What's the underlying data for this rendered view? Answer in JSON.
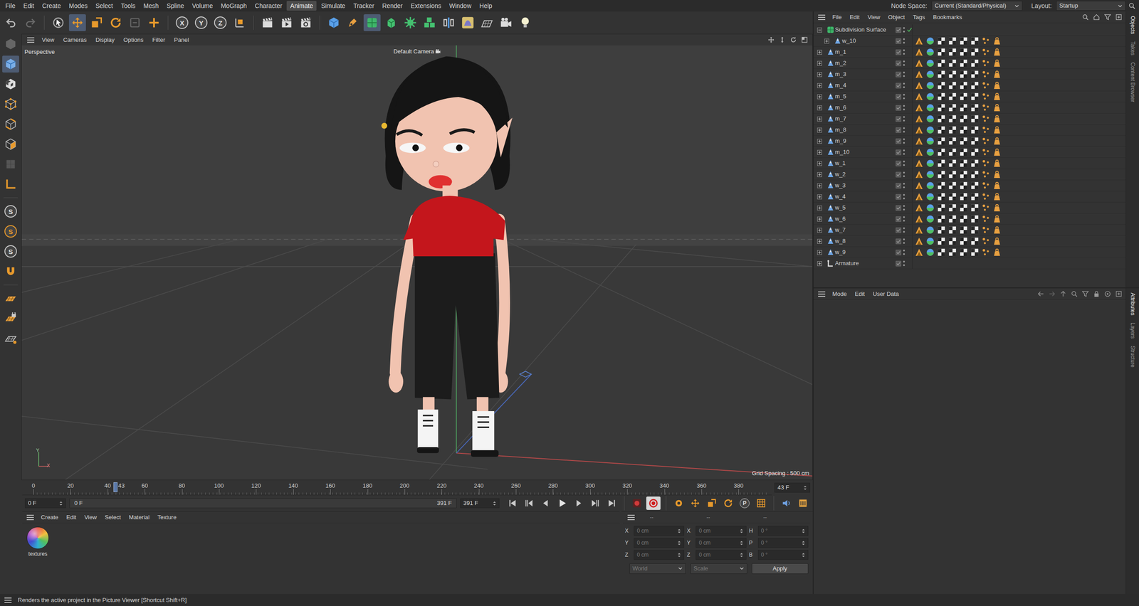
{
  "menubar": {
    "items": [
      {
        "label": "File",
        "selected": false
      },
      {
        "label": "Edit",
        "selected": false
      },
      {
        "label": "Create",
        "selected": false
      },
      {
        "label": "Modes",
        "selected": false
      },
      {
        "label": "Select",
        "selected": false
      },
      {
        "label": "Tools",
        "selected": false
      },
      {
        "label": "Mesh",
        "selected": false
      },
      {
        "label": "Spline",
        "selected": false
      },
      {
        "label": "Volume",
        "selected": false
      },
      {
        "label": "MoGraph",
        "selected": false
      },
      {
        "label": "Character",
        "selected": false
      },
      {
        "label": "Animate",
        "selected": true
      },
      {
        "label": "Simulate",
        "selected": false
      },
      {
        "label": "Tracker",
        "selected": false
      },
      {
        "label": "Render",
        "selected": false
      },
      {
        "label": "Extensions",
        "selected": false
      },
      {
        "label": "Window",
        "selected": false
      },
      {
        "label": "Help",
        "selected": false
      }
    ],
    "node_space": {
      "label": "Node Space:",
      "value": "Current (Standard/Physical)"
    },
    "layout": {
      "label": "Layout:",
      "value": "Startup"
    }
  },
  "toolbar": {
    "tools": [
      {
        "kind": "undo",
        "selected": false
      },
      {
        "kind": "redo",
        "selected": false
      },
      {
        "kind": "separator"
      },
      {
        "kind": "select",
        "selected": false
      },
      {
        "kind": "move",
        "selected": true
      },
      {
        "kind": "scale",
        "selected": false
      },
      {
        "kind": "rotate",
        "selected": false
      },
      {
        "kind": "recent",
        "selected": false
      },
      {
        "kind": "add",
        "selected": false
      },
      {
        "kind": "separator"
      },
      {
        "kind": "axis",
        "label": "X",
        "selected": false
      },
      {
        "kind": "axis",
        "label": "Y",
        "selected": false
      },
      {
        "kind": "axis",
        "label": "Z",
        "selected": false
      },
      {
        "kind": "coord",
        "selected": false
      },
      {
        "kind": "separator"
      },
      {
        "kind": "clapper",
        "selected": false
      },
      {
        "kind": "render",
        "selected": false
      },
      {
        "kind": "rsettings",
        "selected": false
      },
      {
        "kind": "separator"
      },
      {
        "kind": "cube",
        "selected": false
      },
      {
        "kind": "pen",
        "selected": false
      },
      {
        "kind": "subdiv",
        "selected": true
      },
      {
        "kind": "extrude",
        "selected": false
      },
      {
        "kind": "cloner",
        "selected": false
      },
      {
        "kind": "array",
        "selected": false
      },
      {
        "kind": "symmetry",
        "selected": false
      },
      {
        "kind": "deformer",
        "selected": false
      },
      {
        "kind": "floor",
        "selected": false
      },
      {
        "kind": "camera",
        "selected": false
      },
      {
        "kind": "light",
        "selected": false
      }
    ]
  },
  "left_toolbar": {
    "tools": [
      {
        "kind": "model",
        "selected": false
      },
      {
        "kind": "object",
        "selected": true
      },
      {
        "kind": "texture",
        "selected": false
      },
      {
        "kind": "points",
        "selected": false
      },
      {
        "kind": "edges",
        "selected": false
      },
      {
        "kind": "polygons",
        "selected": false
      },
      {
        "kind": "uv",
        "selected": false
      },
      {
        "kind": "axisl",
        "selected": false
      },
      {
        "kind": "separator"
      },
      {
        "kind": "snap",
        "label": "S",
        "selected": false
      },
      {
        "kind": "snap-active",
        "label": "S",
        "selected": false
      },
      {
        "kind": "snap",
        "label": "S",
        "selected": false
      },
      {
        "kind": "magnet",
        "selected": false
      },
      {
        "kind": "separator"
      },
      {
        "kind": "workplane",
        "selected": false
      },
      {
        "kind": "wplock",
        "selected": false
      },
      {
        "kind": "gridsnap",
        "selected": false
      }
    ]
  },
  "viewport": {
    "menu": [
      {
        "label": "View",
        "selected": false
      },
      {
        "label": "Cameras",
        "selected": false
      },
      {
        "label": "Display",
        "selected": false
      },
      {
        "label": "Options",
        "selected": true
      },
      {
        "label": "Filter",
        "selected": false
      },
      {
        "label": "Panel",
        "selected": false
      }
    ],
    "view_name": "Perspective",
    "camera": "Default Camera",
    "grid_spacing": "Grid Spacing : 500 cm",
    "axis": {
      "y": "Y",
      "x": "X"
    }
  },
  "timeline": {
    "ticks": [
      "0",
      "20",
      "40",
      "60",
      "80",
      "100",
      "120",
      "140",
      "160",
      "180",
      "200",
      "220",
      "240",
      "260",
      "280",
      "300",
      "320",
      "340",
      "360",
      "380"
    ],
    "current": "43",
    "level": 0.109,
    "frame": "43 F"
  },
  "transport": {
    "start": "0 F",
    "range_start": "0 F",
    "range_end": "391 F",
    "end": "391 F",
    "controls": [
      {
        "kind": "first",
        "selected": false
      },
      {
        "kind": "prevkey",
        "selected": false
      },
      {
        "kind": "prev",
        "selected": false
      },
      {
        "kind": "play",
        "selected": false
      },
      {
        "kind": "next",
        "selected": false
      },
      {
        "kind": "nextkey",
        "selected": false
      },
      {
        "kind": "last",
        "selected": false
      },
      {
        "kind": "separator"
      },
      {
        "kind": "record",
        "selected": false
      },
      {
        "kind": "autokey",
        "selected": true
      },
      {
        "kind": "separator"
      },
      {
        "kind": "keysel",
        "selected": false
      },
      {
        "kind": "move",
        "selected": false
      },
      {
        "kind": "scale",
        "selected": false
      },
      {
        "kind": "rotate",
        "selected": false
      },
      {
        "kind": "param",
        "label": "P",
        "selected": false
      },
      {
        "kind": "pla",
        "selected": false
      },
      {
        "kind": "separator"
      },
      {
        "kind": "sound",
        "selected": false
      },
      {
        "kind": "tlview",
        "selected": false
      }
    ]
  },
  "materials": {
    "menu": [
      "Create",
      "Edit",
      "View",
      "Select",
      "Material",
      "Texture"
    ],
    "items": [
      {
        "name": "textures",
        "selected": false
      }
    ]
  },
  "coordinates": {
    "headers": [
      "--",
      "--",
      "--"
    ],
    "disabled": true,
    "rows": [
      {
        "pos_label": "X",
        "pos": "0 cm",
        "size_label": "X",
        "size": "0 cm",
        "rot_label": "H",
        "rot": "0 °"
      },
      {
        "pos_label": "Y",
        "pos": "0 cm",
        "size_label": "Y",
        "size": "0 cm",
        "rot_label": "P",
        "rot": "0 °"
      },
      {
        "pos_label": "Z",
        "pos": "0 cm",
        "size_label": "Z",
        "size": "0 cm",
        "rot_label": "B",
        "rot": "0 °"
      }
    ],
    "mode": "World",
    "type": "Scale",
    "apply": "Apply"
  },
  "objects": {
    "menu": [
      {
        "label": "File",
        "selected": false
      },
      {
        "label": "Edit",
        "selected": false
      },
      {
        "label": "View",
        "selected": false
      },
      {
        "label": "Object",
        "selected": false
      },
      {
        "label": "Tags",
        "selected": true
      },
      {
        "label": "Bookmarks",
        "selected": false
      }
    ],
    "items": [
      {
        "name": "Subdivision Surface",
        "kind": "subdivision",
        "child": false,
        "expanded": true,
        "tags": false,
        "checked": true
      },
      {
        "name": "w_10",
        "kind": "mesh",
        "child": true,
        "expanded": false,
        "tags": true,
        "checked": false
      },
      {
        "name": "m_1",
        "kind": "mesh",
        "child": false,
        "expanded": false,
        "tags": true,
        "checked": false
      },
      {
        "name": "m_2",
        "kind": "mesh",
        "child": false,
        "expanded": false,
        "tags": true,
        "checked": false
      },
      {
        "name": "m_3",
        "kind": "mesh",
        "child": false,
        "expanded": false,
        "tags": true,
        "checked": false
      },
      {
        "name": "m_4",
        "kind": "mesh",
        "child": false,
        "expanded": false,
        "tags": true,
        "checked": false
      },
      {
        "name": "m_5",
        "kind": "mesh",
        "child": false,
        "expanded": false,
        "tags": true,
        "checked": false
      },
      {
        "name": "m_6",
        "kind": "mesh",
        "child": false,
        "expanded": false,
        "tags": true,
        "checked": false
      },
      {
        "name": "m_7",
        "kind": "mesh",
        "child": false,
        "expanded": false,
        "tags": true,
        "checked": false
      },
      {
        "name": "m_8",
        "kind": "mesh",
        "child": false,
        "expanded": false,
        "tags": true,
        "checked": false
      },
      {
        "name": "m_9",
        "kind": "mesh",
        "child": false,
        "expanded": false,
        "tags": true,
        "checked": false
      },
      {
        "name": "m_10",
        "kind": "mesh",
        "child": false,
        "expanded": false,
        "tags": true,
        "checked": false
      },
      {
        "name": "w_1",
        "kind": "mesh",
        "child": false,
        "expanded": false,
        "tags": true,
        "checked": false
      },
      {
        "name": "w_2",
        "kind": "mesh",
        "child": false,
        "expanded": false,
        "tags": true,
        "checked": false
      },
      {
        "name": "w_3",
        "kind": "mesh",
        "child": false,
        "expanded": false,
        "tags": true,
        "checked": false
      },
      {
        "name": "w_4",
        "kind": "mesh",
        "child": false,
        "expanded": false,
        "tags": true,
        "checked": false
      },
      {
        "name": "w_5",
        "kind": "mesh",
        "child": false,
        "expanded": false,
        "tags": true,
        "checked": false
      },
      {
        "name": "w_6",
        "kind": "mesh",
        "child": false,
        "expanded": false,
        "tags": true,
        "checked": false
      },
      {
        "name": "w_7",
        "kind": "mesh",
        "child": false,
        "expanded": false,
        "tags": true,
        "checked": false
      },
      {
        "name": "w_8",
        "kind": "mesh",
        "child": false,
        "expanded": false,
        "tags": true,
        "checked": false
      },
      {
        "name": "w_9",
        "kind": "mesh",
        "child": false,
        "expanded": false,
        "tags": true,
        "checked": false
      },
      {
        "name": "Armature",
        "kind": "armature",
        "child": false,
        "expanded": false,
        "tags": false,
        "checked": false
      }
    ]
  },
  "attributes": {
    "menu": [
      "Mode",
      "Edit",
      "User Data"
    ]
  },
  "side_tabs": {
    "top": [
      {
        "label": "Objects",
        "selected": true
      },
      {
        "label": "Takes",
        "selected": false
      },
      {
        "label": "Content Browser",
        "selected": false
      }
    ],
    "bottom": [
      {
        "label": "Attributes",
        "selected": true
      },
      {
        "label": "Layers",
        "selected": false
      },
      {
        "label": "Structure",
        "selected": false
      }
    ]
  },
  "status_bar": "Renders the active project in the Picture Viewer [Shortcut Shift+R]"
}
